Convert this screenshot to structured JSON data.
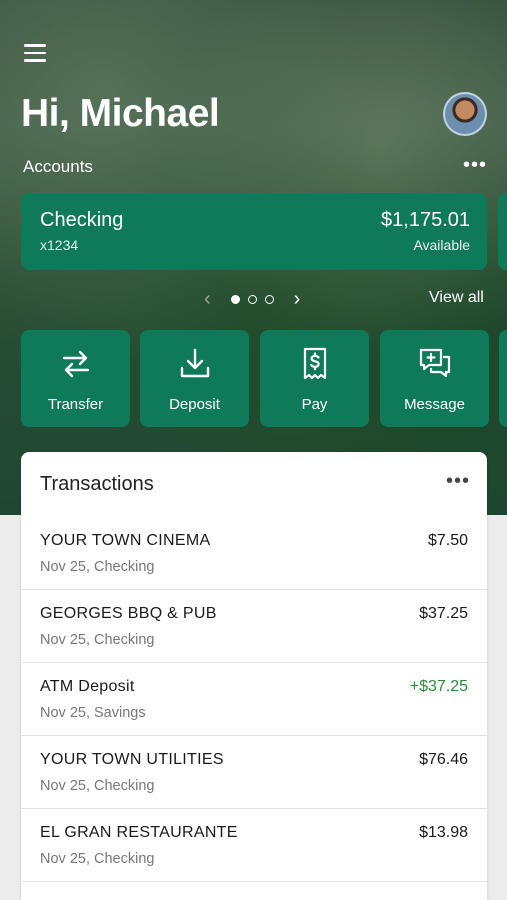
{
  "header": {
    "greeting": "Hi, Michael",
    "menu_icon": "hamburger-menu-icon",
    "avatar": "user-avatar"
  },
  "accounts": {
    "label": "Accounts",
    "more_icon": "more-horizontal-icon",
    "card": {
      "name": "Checking",
      "number": "x1234",
      "balance": "$1,175.01",
      "balance_label": "Available"
    },
    "pager": {
      "pages": 3,
      "active_page": 1
    },
    "view_all": "View all"
  },
  "actions": [
    {
      "label": "Transfer",
      "icon": "transfer-arrows-icon"
    },
    {
      "label": "Deposit",
      "icon": "download-tray-icon"
    },
    {
      "label": "Pay",
      "icon": "dollar-receipt-icon"
    },
    {
      "label": "Message",
      "icon": "chat-plus-icon"
    }
  ],
  "transactions": {
    "title": "Transactions",
    "items": [
      {
        "name": "YOUR TOWN CINEMA",
        "detail": "Nov 25, Checking",
        "amount": "$7.50"
      },
      {
        "name": "GEORGES BBQ & PUB",
        "detail": "Nov 25, Checking",
        "amount": "$37.25"
      },
      {
        "name": "ATM Deposit",
        "detail": "Nov 25, Savings",
        "amount": "+$37.25"
      },
      {
        "name": "YOUR TOWN UTILITIES",
        "detail": "Nov 25, Checking",
        "amount": "$76.46"
      },
      {
        "name": "EL GRAN RESTAURANTE",
        "detail": "Nov 25, Checking",
        "amount": "$13.98"
      }
    ]
  },
  "colors": {
    "accent": "#0f7a5a",
    "credit": "#2e8b3a"
  }
}
